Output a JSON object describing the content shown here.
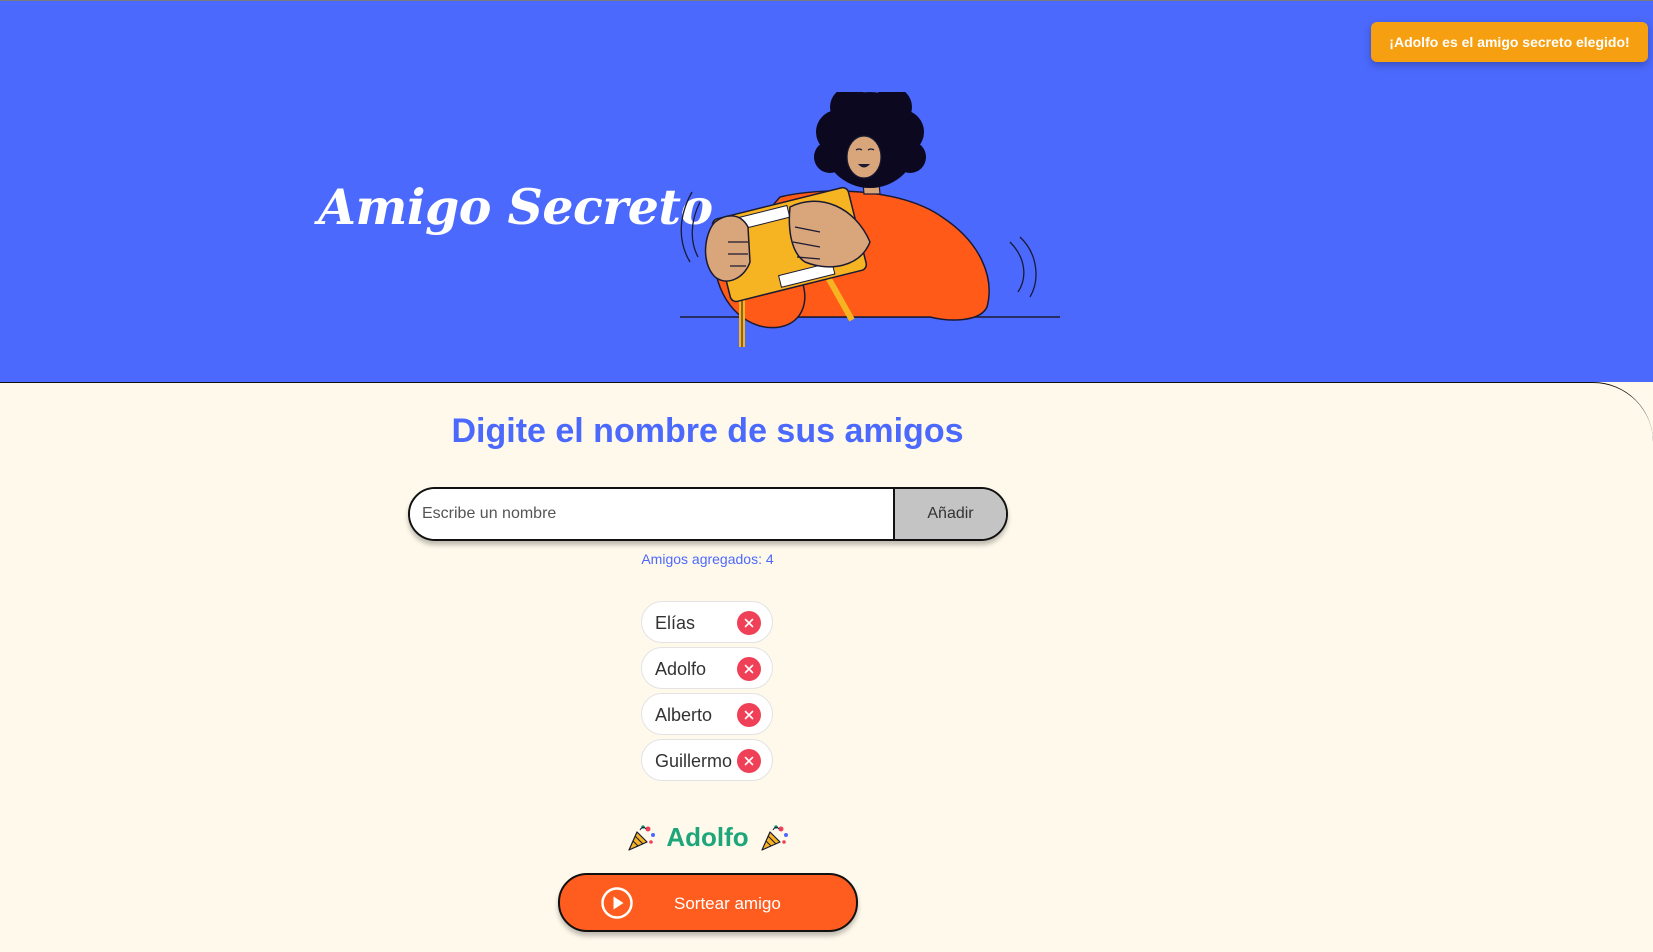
{
  "colors": {
    "hero_background": "#4B69FD",
    "page_background": "#FFF9EB",
    "toast_background": "#F69F11",
    "primary_blue": "#4B69FD",
    "draw_button": "#FF5D1F",
    "remove_button": "#F04058",
    "result_green": "#1CA67A"
  },
  "toast": {
    "message": "¡Adolfo es el amigo secreto elegido!"
  },
  "hero": {
    "title": "Amigo Secreto",
    "illustration": "person-holding-gift-box"
  },
  "main": {
    "section_title": "Digite el nombre de sus amigos",
    "input": {
      "placeholder": "Escribe un nombre",
      "value": ""
    },
    "add_button_label": "Añadir",
    "counter_text": "Amigos agregados: 4",
    "friends": [
      {
        "name": "Elías"
      },
      {
        "name": "Adolfo"
      },
      {
        "name": "Alberto"
      },
      {
        "name": "Guillermo"
      }
    ],
    "remove_icon": "close-icon",
    "result": {
      "name": "Adolfo",
      "icon": "party-popper-icon"
    },
    "draw_button": {
      "label": "Sortear amigo",
      "icon": "play-circle-icon"
    }
  }
}
